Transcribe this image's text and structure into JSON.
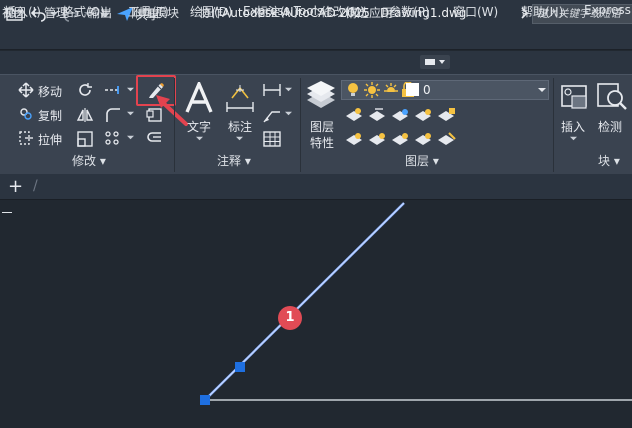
{
  "titlebar": {
    "share_label": "共享",
    "app_title": "Autodesk AutoCAD 2025",
    "doc_title": "Drawing1.dwg",
    "search_placeholder": "键入关键字或短语"
  },
  "menu": {
    "items": [
      "插入(I)",
      "格式(O)",
      "工具(T)",
      "绘图(D)",
      "标注(N)",
      "修改(M)",
      "参数(P)",
      "窗口(W)",
      "帮助(H)",
      "Express"
    ]
  },
  "ribbon_tabs": {
    "items": [
      "视图",
      "管理",
      "输出",
      "附加模块",
      "协作",
      "Express Tools",
      "精选应用"
    ]
  },
  "modify_panel": {
    "move_label": "移动",
    "copy_label": "复制",
    "stretch_label": "拉伸",
    "footer": "修改 ▾"
  },
  "annotation_panel": {
    "text_label": "文字",
    "dimension_label": "标注",
    "footer": "注释 ▾"
  },
  "layers_panel": {
    "layer_props_label_1": "图层",
    "layer_props_label_2": "特性",
    "current_layer": "0",
    "footer": "图层 ▾"
  },
  "block_panel": {
    "insert_label": "插入",
    "detect_label": "检测",
    "footer": "块 ▾"
  },
  "canvas": {
    "grip_label": "1",
    "line_color": "#7fa6ff",
    "grip_color": "#1e6fe0"
  },
  "colors": {
    "accent_red": "#e3434f",
    "background": "#212830"
  }
}
